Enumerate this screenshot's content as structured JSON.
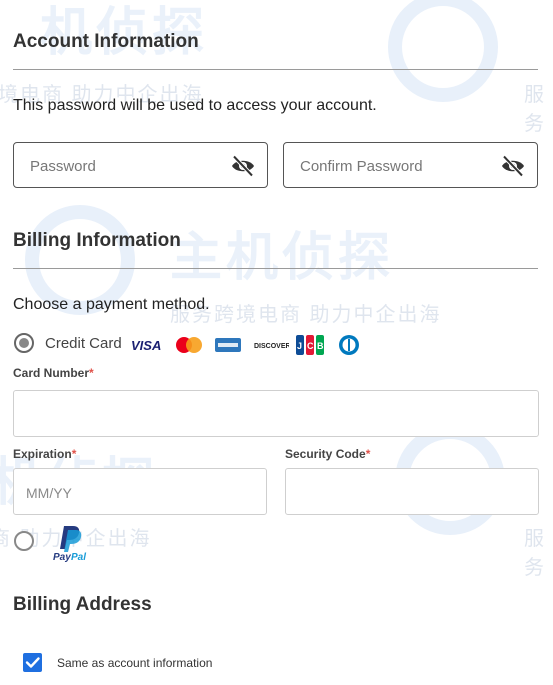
{
  "account": {
    "title": "Account Information",
    "note": "This password will be used to access your account.",
    "password_placeholder": "Password",
    "confirm_placeholder": "Confirm Password"
  },
  "billing": {
    "title": "Billing Information",
    "choose": "Choose a payment method.",
    "credit_card_label": "Credit Card",
    "card_logos": [
      "VISA",
      "Mastercard",
      "American Express",
      "DISCOVER",
      "JCB",
      "Diners Club"
    ],
    "card_number_label": "Card Number",
    "expiration_label": "Expiration",
    "expiration_placeholder": "MM/YY",
    "security_code_label": "Security Code",
    "required_mark": "*",
    "paypal_label": "PayPal"
  },
  "address": {
    "title": "Billing Address",
    "same_as_label": "Same as account information",
    "same_as_checked": true
  },
  "watermark": {
    "brand": "主机侦探",
    "tagline": "服务跨境电商 助力中企出海",
    "fragment_top": "境电商 助力中企出海",
    "fragment_mid": "商 助力中企出海",
    "fragment_right": "服务",
    "fragment_brand": "机侦探"
  },
  "colors": {
    "accent": "#1f6fe0",
    "required": "#e0524a",
    "paypal_dark": "#253b80",
    "paypal_light": "#179bd7"
  }
}
